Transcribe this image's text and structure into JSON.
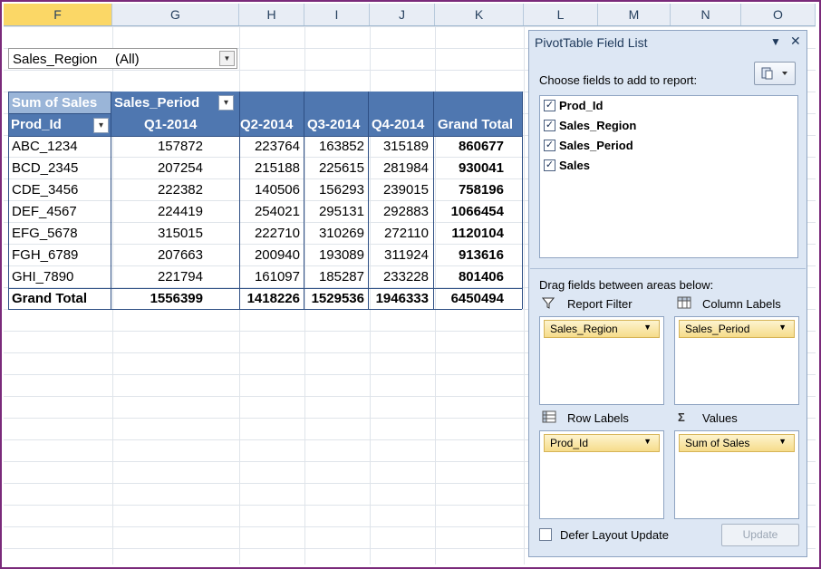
{
  "columns": [
    {
      "letter": "F",
      "selected": true
    },
    {
      "letter": "G",
      "selected": false
    },
    {
      "letter": "H",
      "selected": false
    },
    {
      "letter": "I",
      "selected": false
    },
    {
      "letter": "J",
      "selected": false
    },
    {
      "letter": "K",
      "selected": false
    },
    {
      "letter": "L",
      "selected": false
    },
    {
      "letter": "M",
      "selected": false
    },
    {
      "letter": "N",
      "selected": false
    },
    {
      "letter": "O",
      "selected": false
    }
  ],
  "report_filter": {
    "field": "Sales_Region",
    "value": "(All)"
  },
  "pivot": {
    "value_header": "Sum of Sales",
    "column_field": "Sales_Period",
    "row_field": "Prod_Id",
    "period_headers": [
      "Q1-2014",
      "Q2-2014",
      "Q3-2014",
      "Q4-2014",
      "Grand Total"
    ],
    "rows": [
      {
        "id": "ABC_1234",
        "values": [
          "157872",
          "223764",
          "163852",
          "315189"
        ],
        "total": "860677"
      },
      {
        "id": "BCD_2345",
        "values": [
          "207254",
          "215188",
          "225615",
          "281984"
        ],
        "total": "930041"
      },
      {
        "id": "CDE_3456",
        "values": [
          "222382",
          "140506",
          "156293",
          "239015"
        ],
        "total": "758196"
      },
      {
        "id": "DEF_4567",
        "values": [
          "224419",
          "254021",
          "295131",
          "292883"
        ],
        "total": "1066454"
      },
      {
        "id": "EFG_5678",
        "values": [
          "315015",
          "222710",
          "310269",
          "272110"
        ],
        "total": "1120104"
      },
      {
        "id": "FGH_6789",
        "values": [
          "207663",
          "200940",
          "193089",
          "311924"
        ],
        "total": "913616"
      },
      {
        "id": "GHI_7890",
        "values": [
          "221794",
          "161097",
          "185287",
          "233228"
        ],
        "total": "801406"
      }
    ],
    "grand_total": {
      "label": "Grand Total",
      "values": [
        "1556399",
        "1418226",
        "1529536",
        "1946333"
      ],
      "total": "6450494"
    }
  },
  "field_list": {
    "title": "PivotTable Field List",
    "choose_label": "Choose fields to add to report:",
    "fields": [
      {
        "name": "Prod_Id",
        "checked": true
      },
      {
        "name": "Sales_Region",
        "checked": true
      },
      {
        "name": "Sales_Period",
        "checked": true
      },
      {
        "name": "Sales",
        "checked": true
      }
    ],
    "drag_label": "Drag fields between areas below:",
    "areas": {
      "report_filter": {
        "label": "Report Filter",
        "item": "Sales_Region"
      },
      "column_labels": {
        "label": "Column Labels",
        "item": "Sales_Period"
      },
      "row_labels": {
        "label": "Row Labels",
        "item": "Prod_Id"
      },
      "values": {
        "label": "Values",
        "item": "Sum of Sales"
      }
    },
    "defer_label": "Defer Layout Update",
    "update_label": "Update"
  },
  "colors": {
    "header_blue": "#4f77b0",
    "selected_column": "#fbd766",
    "panel_bg": "#dde7f4",
    "frame": "#7a2a7a"
  }
}
